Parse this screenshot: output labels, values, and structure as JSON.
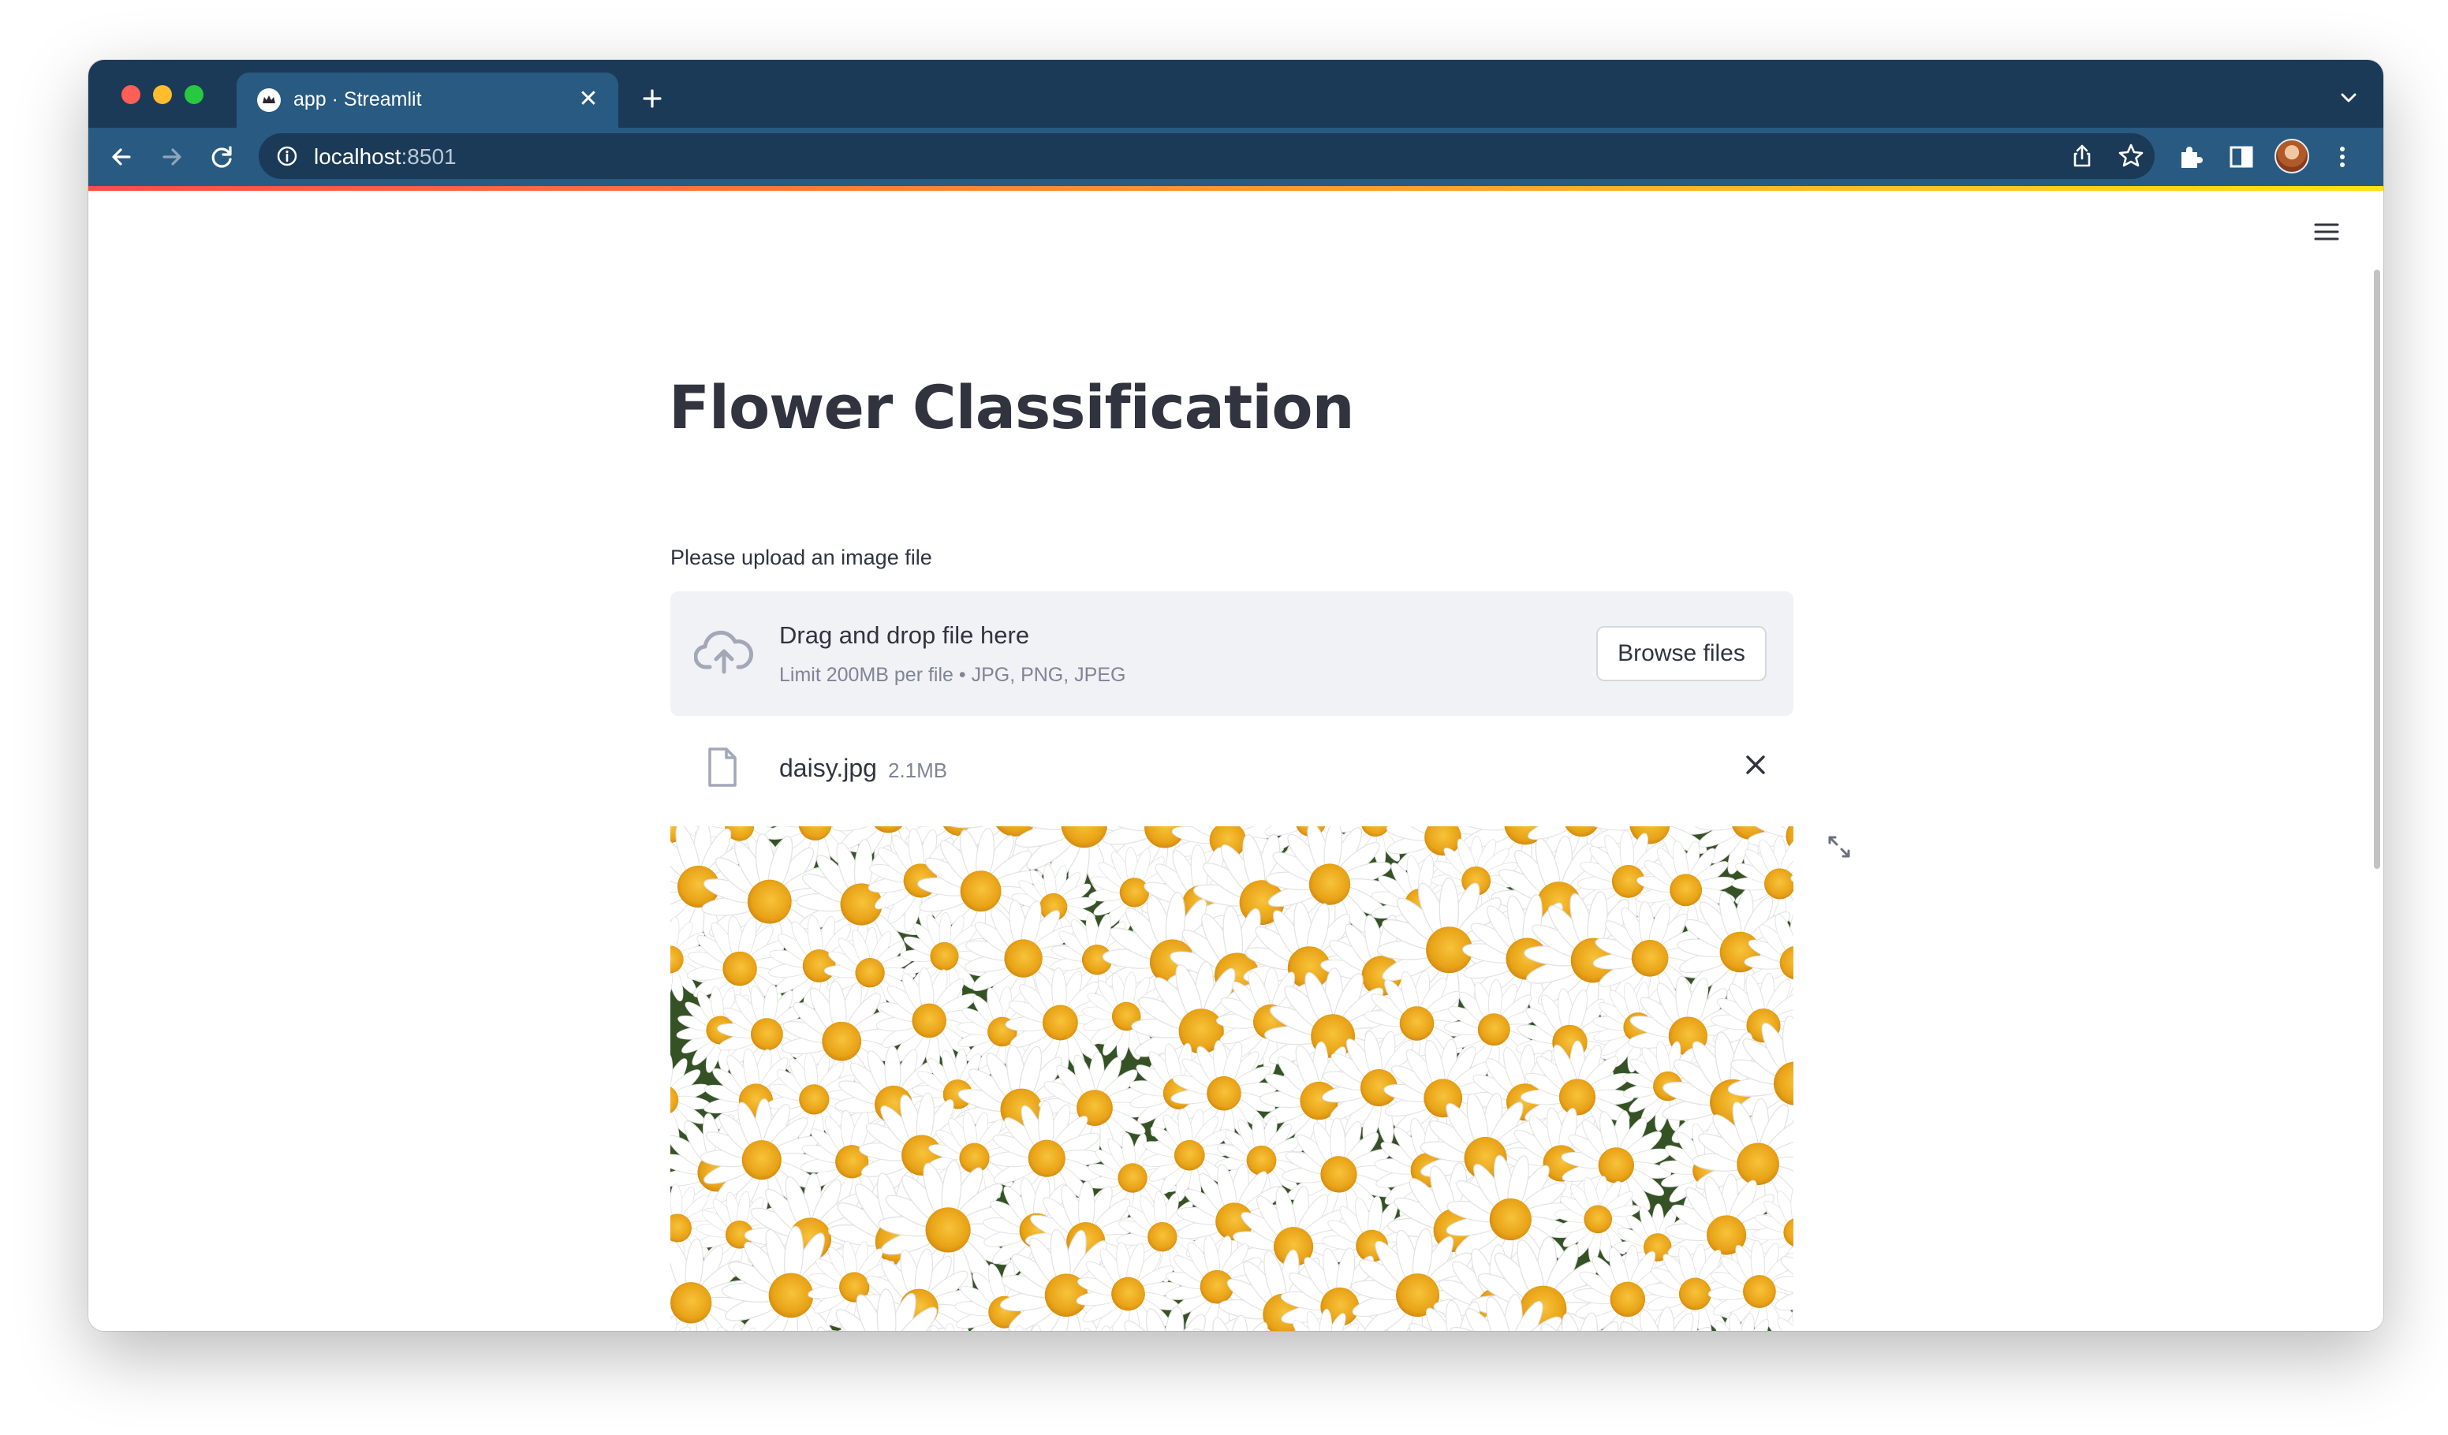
{
  "browser": {
    "tab_title": "app · Streamlit",
    "tab_close_glyph": "✕",
    "url_host": "localhost",
    "url_port": ":8501"
  },
  "icons": {
    "traffic_lights": [
      "close",
      "minimize",
      "zoom"
    ],
    "toolbar": [
      "back-icon",
      "forward-icon",
      "reload-icon",
      "share-icon",
      "bookmark-star-icon",
      "extensions-icon",
      "side-panel-icon",
      "profile-avatar",
      "more-menu-icon"
    ],
    "app": [
      "hamburger-menu-icon",
      "cloud-upload-icon",
      "file-icon",
      "close-icon",
      "fullscreen-icon"
    ]
  },
  "colors": {
    "browser_frame": "#1b3a57",
    "active_tab": "#285a82",
    "text_primary": "#31333f",
    "text_secondary": "#808495",
    "dropzone_bg": "#f0f2f6",
    "decoration_start": "#ff4b4b",
    "decoration_end": "#ffe312"
  },
  "app": {
    "title": "Flower Classification",
    "uploader": {
      "label": "Please upload an image file",
      "drag_text": "Drag and drop file here",
      "limit_text": "Limit 200MB per file • JPG, PNG, JPEG",
      "browse_label": "Browse files"
    },
    "uploaded_file": {
      "name": "daisy.jpg",
      "size": "2.1MB"
    },
    "image": {
      "subject": "field of white daisies with yellow centers"
    }
  }
}
